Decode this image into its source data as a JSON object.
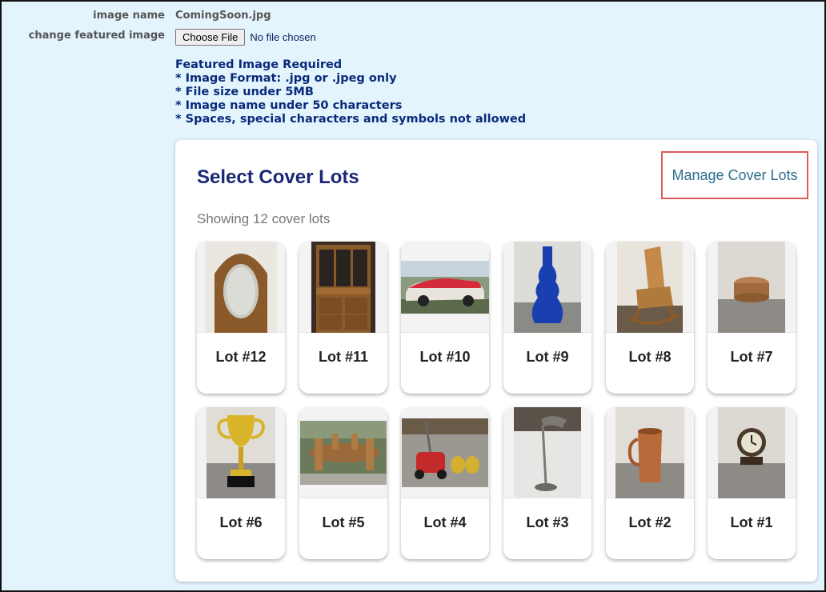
{
  "form": {
    "image_name_label": "image name",
    "image_name_value": "ComingSoon.jpg",
    "change_label": "change featured image",
    "choose_file_label": "Choose File",
    "file_status": "No file chosen"
  },
  "requirements": [
    "Featured Image Required",
    "* Image Format: .jpg or .jpeg only",
    "* File size under 5MB",
    "* Image name under 50 characters",
    "* Spaces, special characters and symbols not allowed"
  ],
  "cover": {
    "title": "Select Cover Lots",
    "manage_link": "Manage Cover Lots",
    "showing_text": "Showing 12 cover lots",
    "lots": [
      {
        "label": "Lot #12",
        "image": "wooden-oval-mirror"
      },
      {
        "label": "Lot #11",
        "image": "wooden-hutch-cabinet"
      },
      {
        "label": "Lot #10",
        "image": "red-white-convertible-car"
      },
      {
        "label": "Lot #9",
        "image": "blue-glass-vase"
      },
      {
        "label": "Lot #8",
        "image": "wooden-rocking-chair"
      },
      {
        "label": "Lot #7",
        "image": "ornate-trinket-box"
      },
      {
        "label": "Lot #6",
        "image": "gold-trophy-cup"
      },
      {
        "label": "Lot #5",
        "image": "wooden-dining-set"
      },
      {
        "label": "Lot #4",
        "image": "toy-lawn-mower-and-figurines"
      },
      {
        "label": "Lot #3",
        "image": "metal-desk-lamp"
      },
      {
        "label": "Lot #2",
        "image": "copper-mug"
      },
      {
        "label": "Lot #1",
        "image": "vintage-alarm-clock"
      }
    ]
  },
  "colors": {
    "page_bg": "#e3f4fd",
    "title": "#1a2875",
    "link": "#2b6d8f",
    "highlight_border": "#e05a5a",
    "requirements_text": "#0a2a7a"
  }
}
